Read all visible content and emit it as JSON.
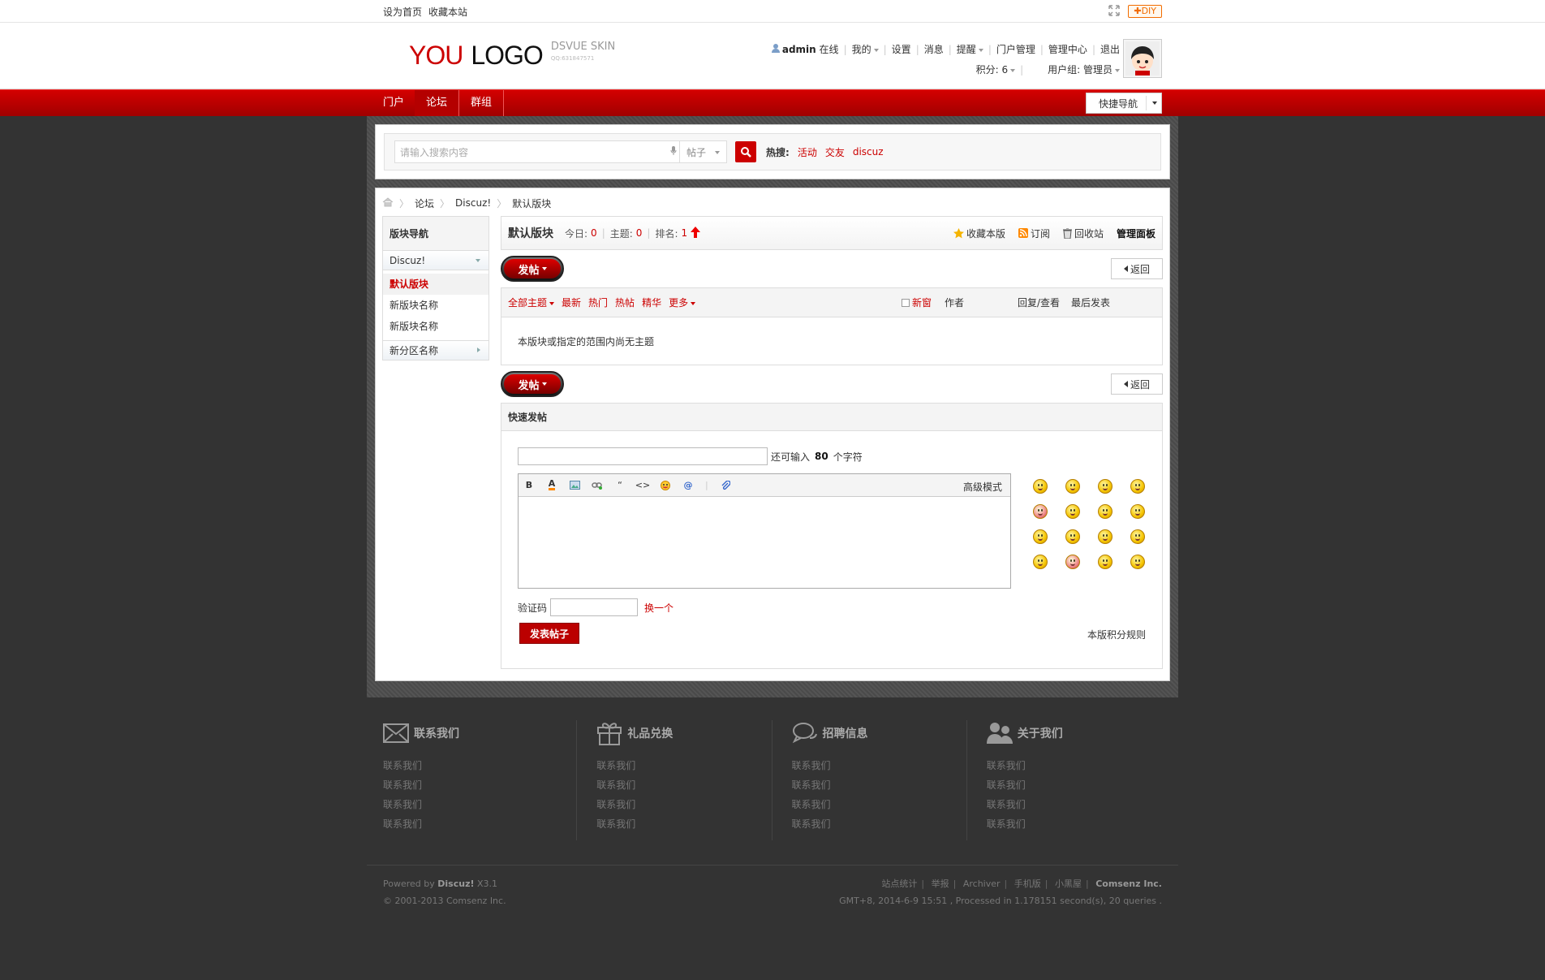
{
  "topbar": {
    "set_home": "设为首页",
    "bookmark": "收藏本站",
    "diy": "DIY"
  },
  "logo": {
    "you": "YOU",
    "logo": "LOGO",
    "skin": "DSVUE SKIN",
    "sub": "QQ:631847571"
  },
  "user": {
    "name": "admin",
    "status": "在线",
    "mine": "我的",
    "settings": "设置",
    "messages": "消息",
    "remind": "提醒",
    "portal_admin": "门户管理",
    "admin_center": "管理中心",
    "logout": "退出",
    "credits": "积分: 6",
    "group": "用户组: 管理员"
  },
  "nav": {
    "items": [
      "门户",
      "论坛",
      "群组"
    ],
    "active": 1,
    "quick": "快捷导航"
  },
  "search": {
    "placeholder": "请输入搜索内容",
    "type": "帖子",
    "hot_label": "热搜:",
    "hot": [
      "活动",
      "交友",
      "discuz"
    ]
  },
  "breadcrumb": [
    "论坛",
    "Discuz!",
    "默认版块"
  ],
  "sidebar": {
    "title": "版块导航",
    "group1": "Discuz!",
    "items": [
      "默认版块",
      "新版块名称",
      "新版块名称"
    ],
    "group2": "新分区名称"
  },
  "forum": {
    "name": "默认版块",
    "today_label": "今日:",
    "today": "0",
    "threads_label": "主题:",
    "threads": "0",
    "rank_label": "排名:",
    "rank": "1",
    "fav": "收藏本版",
    "rss": "订阅",
    "recycle": "回收站",
    "manage": "管理面板"
  },
  "buttons": {
    "post": "发帖",
    "back": "返回"
  },
  "threadlist": {
    "filters": [
      "全部主题",
      "最新",
      "热门",
      "热帖",
      "精华",
      "更多"
    ],
    "new_window": "新窗",
    "author": "作者",
    "reply_view": "回复/查看",
    "last_post": "最后发表",
    "empty": "本版块或指定的范围内尚无主题"
  },
  "quickpost": {
    "title": "快速发帖",
    "remain_prefix": "还可输入",
    "remain": "80",
    "remain_suffix": "个字符",
    "adv": "高级模式",
    "captcha": "验证码",
    "refresh": "换一个",
    "submit": "发表帖子",
    "rules": "本版积分规则"
  },
  "footer": {
    "cols": [
      {
        "title": "联系我们",
        "icon": "mail-icon",
        "links": [
          "联系我们",
          "联系我们",
          "联系我们",
          "联系我们"
        ]
      },
      {
        "title": "礼品兑换",
        "icon": "gift-icon",
        "links": [
          "联系我们",
          "联系我们",
          "联系我们",
          "联系我们"
        ]
      },
      {
        "title": "招聘信息",
        "icon": "chat-icon",
        "links": [
          "联系我们",
          "联系我们",
          "联系我们",
          "联系我们"
        ]
      },
      {
        "title": "关于我们",
        "icon": "users-icon",
        "links": [
          "联系我们",
          "联系我们",
          "联系我们",
          "联系我们"
        ]
      }
    ],
    "powered": "Powered by",
    "discuz": "Discuz!",
    "ver": "X3.1",
    "copy": "© 2001-2013 Comsenz Inc.",
    "links": [
      "站点统计",
      "举报",
      "Archiver",
      "手机版",
      "小黑屋"
    ],
    "company": "Comsenz Inc.",
    "stats": "GMT+8, 2014-6-9 15:51 , Processed in 1.178151 second(s), 20 queries ."
  },
  "colors": {
    "brand": "#cc0000",
    "text": "#333333",
    "bg": "#333333"
  }
}
